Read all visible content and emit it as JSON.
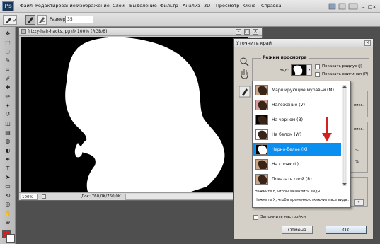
{
  "menubar": {
    "logo": "Ps",
    "items": [
      "Файл",
      "Редактирование",
      "Изображение",
      "Слои",
      "Выделение",
      "Фильтр",
      "Анализ",
      "3D",
      "Просмотр",
      "Окно",
      "Справка"
    ]
  },
  "options": {
    "size_label": "Размер:",
    "size_value": "35"
  },
  "toolbar": {
    "tools": [
      "move-icon",
      "marquee-icon",
      "lasso-icon",
      "quick-select-icon",
      "crop-icon",
      "eyedropper-icon",
      "healing-icon",
      "brush-icon",
      "stamp-icon",
      "history-brush-icon",
      "eraser-icon",
      "gradient-icon",
      "blur-icon",
      "dodge-icon",
      "pen-icon",
      "type-icon",
      "path-select-icon",
      "shape-icon",
      "3d-rotate-icon",
      "3d-orbit-icon",
      "hand-icon",
      "zoom-icon"
    ],
    "foreground_color": "#e31a1a",
    "background_color": "#ffffff"
  },
  "document": {
    "title": "frizzy-hair-hacks.jpg @ 100% (RGB/8)",
    "zoom": "100%",
    "info": "Док: 760,0К/760,0К"
  },
  "dialog": {
    "title": "Уточнить край",
    "view_group_title": "Режим просмотра",
    "view_label": "Вид:",
    "show_radius": "Показать радиус (J)",
    "show_original": "Показать оригинал (P)",
    "side_texts": [
      "пикс.",
      "пикс.",
      "%",
      "%"
    ],
    "remember_settings": "Запомнить настройки",
    "cancel": "Отмена",
    "ok": "OK"
  },
  "dropdown": {
    "items": [
      {
        "label": "Марширующие муравьи (M)",
        "selected": false
      },
      {
        "label": "Наложение (V)",
        "selected": false
      },
      {
        "label": "На черном (B)",
        "selected": false
      },
      {
        "label": "На белом (W)",
        "selected": false
      },
      {
        "label": "Черно-белое (K)",
        "selected": true
      },
      {
        "label": "На слоях (L)",
        "selected": false
      },
      {
        "label": "Показать слой (R)",
        "selected": false
      }
    ],
    "hint_1": "Нажмите F, чтобы зациклить виды.",
    "hint_2": "Нажмите X, чтобы временно отключить все виды."
  },
  "colors": {
    "selection_highlight": "#0a8ef0",
    "annotation_arrow": "#d42020"
  }
}
